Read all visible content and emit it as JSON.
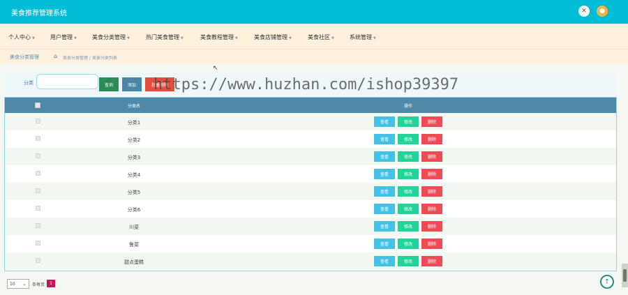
{
  "app": {
    "title": "美食推荐管理系统"
  },
  "topbar": {
    "tool_icon_1": "close-circle-icon",
    "tool_icon_2": "user-avatar-icon"
  },
  "nav": {
    "items": [
      {
        "label": "个人中心"
      },
      {
        "label": "用户管理"
      },
      {
        "label": "美食分类管理"
      },
      {
        "label": "热门美食管理"
      },
      {
        "label": "美食教程管理"
      },
      {
        "label": "美食店铺管理"
      },
      {
        "label": "美食社区"
      },
      {
        "label": "系统管理"
      }
    ],
    "caret": "▼"
  },
  "breadcrumb": {
    "title": "美食分类管理",
    "path": "美食分类管理 / 美食分类列表"
  },
  "search": {
    "label": "分类",
    "value": "",
    "placeholder": "",
    "query_label": "查询",
    "add_label": "添加",
    "batch_delete_label": "批量删除"
  },
  "watermark": "https://www.huzhan.com/ishop39397",
  "table": {
    "headers": {
      "name": "分类名",
      "ops": "操作"
    },
    "action_labels": {
      "view": "查看",
      "edit": "修改",
      "delete": "删除"
    },
    "rows": [
      {
        "name": "分类1"
      },
      {
        "name": "分类2"
      },
      {
        "name": "分类3"
      },
      {
        "name": "分类4"
      },
      {
        "name": "分类5"
      },
      {
        "name": "分类6"
      },
      {
        "name": "川菜"
      },
      {
        "name": "鲁菜"
      },
      {
        "name": "甜点蛋糕"
      }
    ]
  },
  "pager": {
    "page_size": "10",
    "per_page_label": "条每页",
    "current_page": "1"
  },
  "colors": {
    "topbar": "#00bcd4",
    "navbar": "#fdf0dc",
    "table_header": "#4e8aa8",
    "view_button": "#45c0e6",
    "edit_button": "#22d39a",
    "delete_button": "#ef4b55",
    "page_active": "#c2185b"
  }
}
